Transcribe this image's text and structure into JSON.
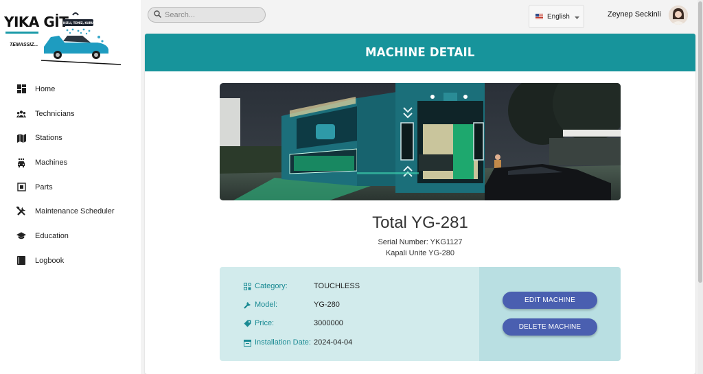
{
  "app": {
    "brand": "YIKA GİT",
    "brand_tagline": "TEMASSIZ...",
    "logo_badge": "HIZLI, TEMİZ, KURU"
  },
  "sidebar": {
    "items": [
      {
        "label": "Home",
        "icon": "dashboard-icon"
      },
      {
        "label": "Technicians",
        "icon": "group-icon"
      },
      {
        "label": "Stations",
        "icon": "map-icon"
      },
      {
        "label": "Machines",
        "icon": "car-wash-icon"
      },
      {
        "label": "Parts",
        "icon": "chip-icon"
      },
      {
        "label": "Maintenance Scheduler",
        "icon": "tools-icon"
      },
      {
        "label": "Education",
        "icon": "graduation-cap-icon"
      },
      {
        "label": "Logbook",
        "icon": "book-icon"
      }
    ]
  },
  "topbar": {
    "search_placeholder": "Search...",
    "language": "English",
    "user_name": "Zeynep Seckinli"
  },
  "page": {
    "title": "MACHINE DETAIL",
    "machine_name": "Total YG-281",
    "serial_line": "Serial Number: YKG1127",
    "subname": "Kapali Unite YG-280",
    "details": [
      {
        "key": "Category:",
        "value": "TOUCHLESS",
        "icon": "category-icon"
      },
      {
        "key": "Model:",
        "value": "YG-280",
        "icon": "wrench-icon"
      },
      {
        "key": "Price:",
        "value": "3000000",
        "icon": "tag-icon"
      },
      {
        "key": "Installation Date:",
        "value": "2024-04-04",
        "icon": "calendar-icon"
      }
    ],
    "edit_button": "EDIT MACHINE",
    "delete_button": "DELETE MACHINE"
  },
  "colors": {
    "accent": "#17949b",
    "button": "#4a5fb0",
    "panel_left": "#d2ebec",
    "panel_right": "#b9dfe2"
  }
}
